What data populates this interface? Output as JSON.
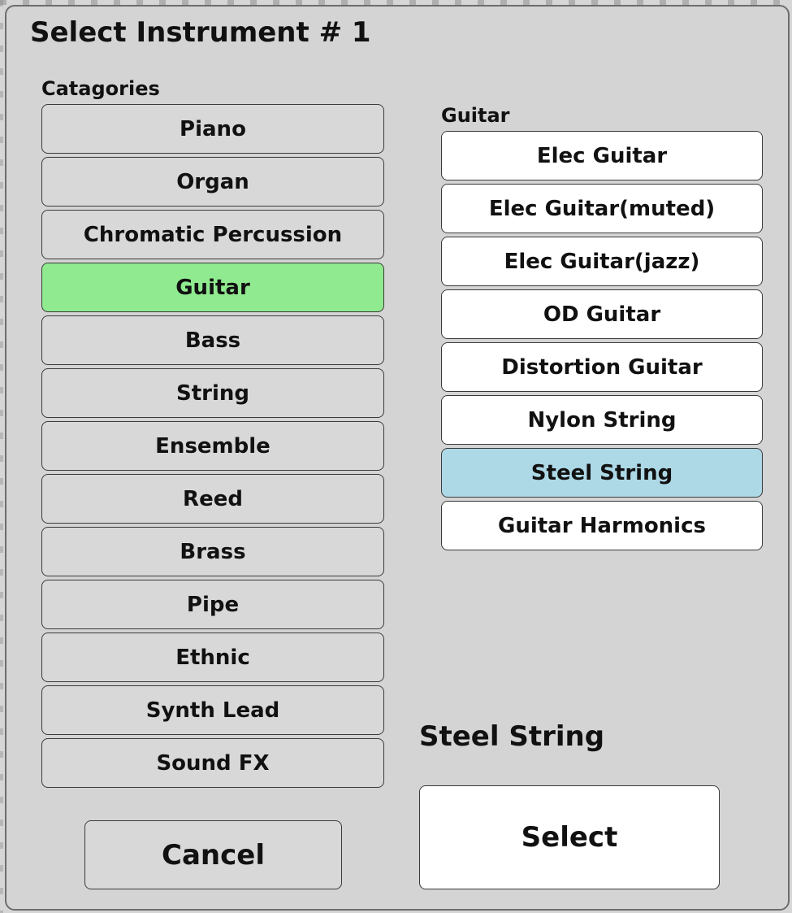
{
  "dialog": {
    "title": "Select Instrument # 1"
  },
  "categories": {
    "label": "Catagories",
    "selected_index": 3,
    "items": [
      {
        "label": "Piano"
      },
      {
        "label": "Organ"
      },
      {
        "label": "Chromatic Percussion"
      },
      {
        "label": "Guitar"
      },
      {
        "label": "Bass"
      },
      {
        "label": "String"
      },
      {
        "label": "Ensemble"
      },
      {
        "label": "Reed"
      },
      {
        "label": "Brass"
      },
      {
        "label": "Pipe"
      },
      {
        "label": "Ethnic"
      },
      {
        "label": "Synth Lead"
      },
      {
        "label": "Sound FX"
      }
    ]
  },
  "instruments": {
    "label": "Guitar",
    "selected_index": 6,
    "items": [
      {
        "label": "Elec Guitar"
      },
      {
        "label": "Elec Guitar(muted)"
      },
      {
        "label": "Elec Guitar(jazz)"
      },
      {
        "label": "OD Guitar"
      },
      {
        "label": "Distortion Guitar"
      },
      {
        "label": "Nylon String"
      },
      {
        "label": "Steel String"
      },
      {
        "label": "Guitar Harmonics"
      }
    ]
  },
  "selection": {
    "current_name": "Steel String"
  },
  "actions": {
    "cancel_label": "Cancel",
    "select_label": "Select"
  },
  "colors": {
    "dialog_background": "#d4d4d4",
    "selected_category": "#90ea8f",
    "selected_instrument": "#add8e6",
    "instrument_button": "#ffffff"
  }
}
